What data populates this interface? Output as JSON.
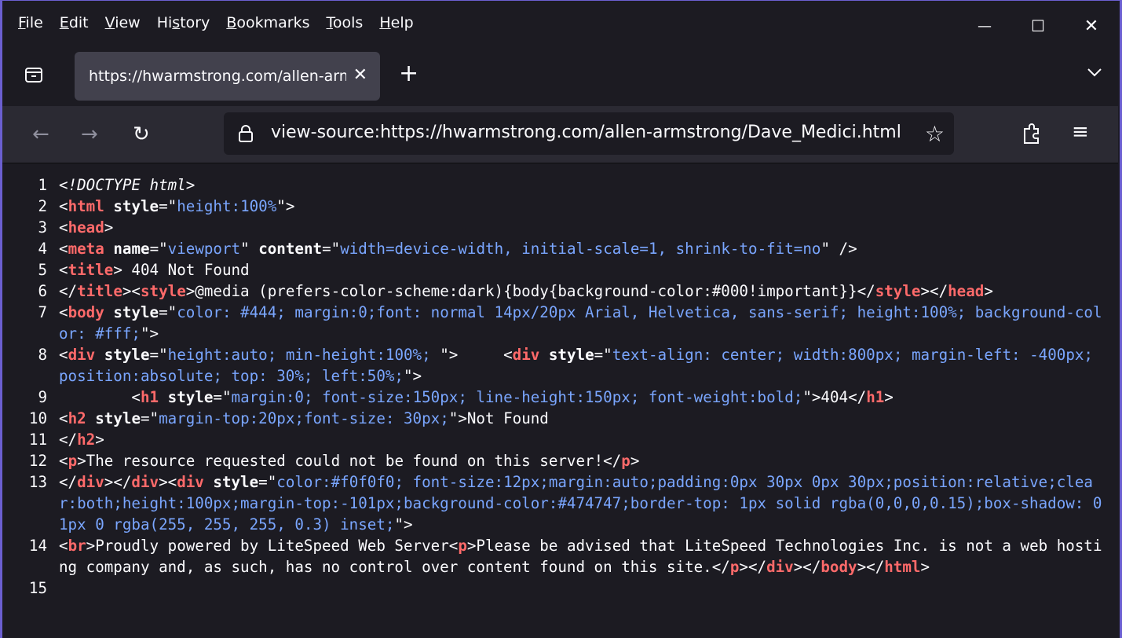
{
  "menu": {
    "items": [
      {
        "label": "File",
        "ul": "F"
      },
      {
        "label": "Edit",
        "ul": "E"
      },
      {
        "label": "View",
        "ul": "V"
      },
      {
        "label": "History",
        "ul": "s"
      },
      {
        "label": "Bookmarks",
        "ul": "B"
      },
      {
        "label": "Tools",
        "ul": "T"
      },
      {
        "label": "Help",
        "ul": "H"
      }
    ]
  },
  "tab": {
    "title": "https://hwarmstrong.com/allen-armstrong/Dave_Medici.html",
    "close_glyph": "✕",
    "new_glyph": "+"
  },
  "window": {
    "min": "—",
    "max": "☐",
    "close": "✕"
  },
  "navbar": {
    "back": "←",
    "forward": "→",
    "reload": "↻",
    "url": "view-source:https://hwarmstrong.com/allen-armstrong/Dave_Medici.html",
    "star": "☆",
    "menu": "≡"
  },
  "source_lines": [
    {
      "n": "1",
      "html": "<span class=\"dt\">&lt;!DOCTYPE html&gt;</span>"
    },
    {
      "n": "2",
      "html": "&lt;<span class=\"tagred\">html</span> <span class=\"attr\">style</span>=\"<span class=\"val\">height:100%</span>\"&gt;"
    },
    {
      "n": "3",
      "html": "&lt;<span class=\"tagred\">head</span>&gt;"
    },
    {
      "n": "4",
      "html": "&lt;<span class=\"tagred\">meta</span> <span class=\"attr\">name</span>=\"<span class=\"val\">viewport</span>\" <span class=\"attr\">content</span>=\"<span class=\"val\">width=device-width, initial-scale=1, shrink-to-fit=no</span>\" /&gt;"
    },
    {
      "n": "5",
      "html": "&lt;<span class=\"tagred\">title</span>&gt; 404 Not Found"
    },
    {
      "n": "6",
      "html": "&lt;/<span class=\"tagred\">title</span>&gt;&lt;<span class=\"tagred\">style</span>&gt;@media (prefers-color-scheme:dark){body{background-color:#000!important}}&lt;/<span class=\"tagred\">style</span>&gt;&lt;/<span class=\"tagred\">head</span>&gt;"
    },
    {
      "n": "7",
      "html": "&lt;<span class=\"tagred\">body</span> <span class=\"attr\">style</span>=\"<span class=\"val\">color: #444; margin:0;font: normal 14px/20px Arial, Helvetica, sans-serif; height:100%; background-color: #fff;</span>\"&gt;"
    },
    {
      "n": "8",
      "html": "&lt;<span class=\"tagred\">div</span> <span class=\"attr\">style</span>=\"<span class=\"val\">height:auto; min-height:100%; </span>\"&gt;     &lt;<span class=\"tagred\">div</span> <span class=\"attr\">style</span>=\"<span class=\"val\">text-align: center; width:800px; margin-left: -400px; position:absolute; top: 30%; left:50%;</span>\"&gt;"
    },
    {
      "n": "9",
      "html": "        &lt;<span class=\"tagred\">h1</span> <span class=\"attr\">style</span>=\"<span class=\"val\">margin:0; font-size:150px; line-height:150px; font-weight:bold;</span>\"&gt;404&lt;/<span class=\"tagred\">h1</span>&gt;"
    },
    {
      "n": "10",
      "html": "&lt;<span class=\"tagred\">h2</span> <span class=\"attr\">style</span>=\"<span class=\"val\">margin-top:20px;font-size: 30px;</span>\"&gt;Not Found"
    },
    {
      "n": "11",
      "html": "&lt;/<span class=\"tagred\">h2</span>&gt;"
    },
    {
      "n": "12",
      "html": "&lt;<span class=\"tagred\">p</span>&gt;The resource requested could not be found on this server!&lt;/<span class=\"tagred\">p</span>&gt;"
    },
    {
      "n": "13",
      "html": "&lt;/<span class=\"tagred\">div</span>&gt;&lt;/<span class=\"tagred\">div</span>&gt;&lt;<span class=\"tagred\">div</span> <span class=\"attr\">style</span>=\"<span class=\"val\">color:#f0f0f0; font-size:12px;margin:auto;padding:0px 30px 0px 30px;position:relative;clear:both;height:100px;margin-top:-101px;background-color:#474747;border-top: 1px solid rgba(0,0,0,0.15);box-shadow: 0 1px 0 rgba(255, 255, 255, 0.3) inset;</span>\"&gt;"
    },
    {
      "n": "14",
      "html": "&lt;<span class=\"tagred\">br</span>&gt;Proudly powered by LiteSpeed Web Server&lt;<span class=\"tagred\">p</span>&gt;Please be advised that LiteSpeed Technologies Inc. is not a web hosting company and, as such, has no control over content found on this site.&lt;/<span class=\"tagred\">p</span>&gt;&lt;/<span class=\"tagred\">div</span>&gt;&lt;/<span class=\"tagred\">body</span>&gt;&lt;/<span class=\"tagred\">html</span>&gt;"
    },
    {
      "n": "15",
      "html": ""
    }
  ]
}
